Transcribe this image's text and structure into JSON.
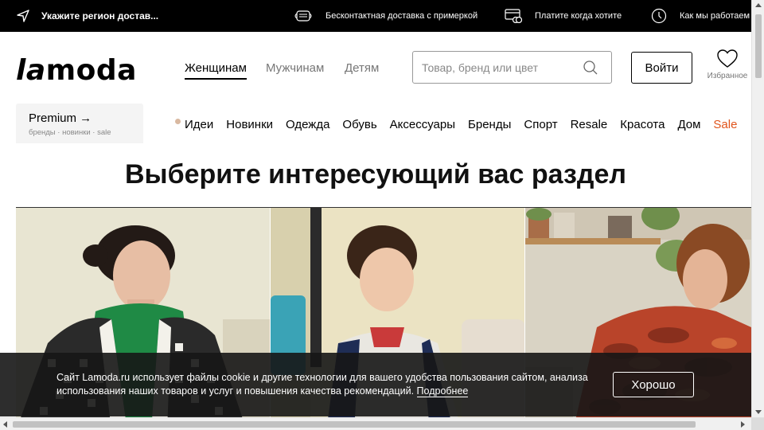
{
  "topbar": {
    "region_label": "Укажите регион достав...",
    "items": [
      {
        "label": "Бесконтактная доставка с примеркой",
        "icon": "mask-icon"
      },
      {
        "label": "Платите когда хотите",
        "icon": "card-icon"
      },
      {
        "label": "Как мы работаем",
        "icon": "clock-icon"
      }
    ]
  },
  "header": {
    "logo_la": "la",
    "logo_moda": "moda",
    "genders": [
      "Женщинам",
      "Мужчинам",
      "Детям"
    ],
    "active_gender": "Женщинам",
    "search_placeholder": "Товар, бренд или цвет",
    "login_label": "Войти",
    "favorites_label": "Избранное"
  },
  "premium": {
    "title": "Premium →",
    "subtitle": "бренды · новинки · sale"
  },
  "categories": [
    "Идеи",
    "Новинки",
    "Одежда",
    "Обувь",
    "Аксессуары",
    "Бренды",
    "Спорт",
    "Resale",
    "Красота",
    "Дом",
    "Sale"
  ],
  "main": {
    "heading": "Выберите интересующий вас раздел"
  },
  "cookie": {
    "text": "Сайт Lamoda.ru использует файлы cookie и другие технологии для вашего удобства пользования сайтом, анализа использования наших товаров и услуг и повышения качества рекомендаций.",
    "more_link": "Подробнее",
    "ok_label": "Хорошо"
  },
  "colors": {
    "topbar_bg": "#000000",
    "sale": "#e0541b",
    "premium_bg": "#f4f4f4",
    "banner_bg": "#161616"
  }
}
